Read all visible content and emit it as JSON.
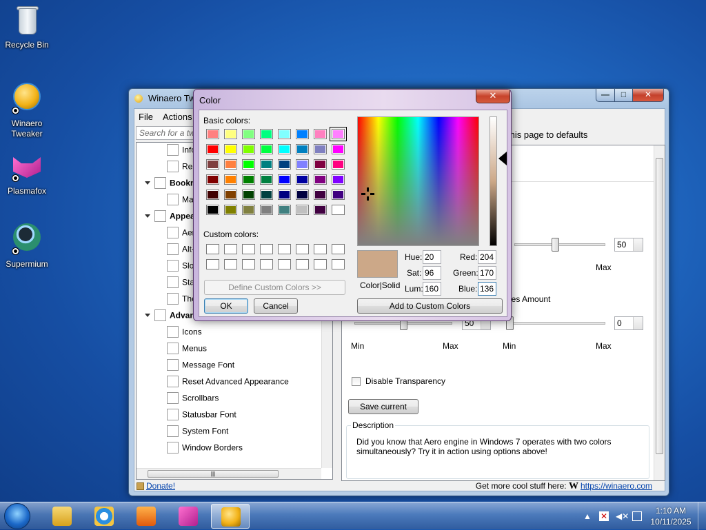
{
  "desktop": {
    "icons": [
      {
        "label": "Recycle Bin",
        "icon": "recycle-bin-icon"
      },
      {
        "label": "Winaero\nTweaker",
        "icon": "winaero-tweaker-icon"
      },
      {
        "label": "Plasmafox",
        "icon": "plasmafox-icon"
      },
      {
        "label": "Supermium",
        "icon": "supermium-icon"
      }
    ]
  },
  "window": {
    "title": "Winaero Twe",
    "menu": [
      "File",
      "Actions"
    ],
    "search_placeholder": "Search for a twe",
    "reset_link": "this page to defaults",
    "tree": [
      {
        "label": "Info",
        "icon": "info-icon",
        "bold": false
      },
      {
        "label": "Res",
        "icon": "refresh-icon",
        "bold": false
      },
      {
        "label": "Bookm",
        "icon": "star-icon",
        "bold": true
      },
      {
        "label": "Ma",
        "icon": "star-icon",
        "bold": false
      },
      {
        "label": "Appea",
        "icon": "palette-icon",
        "bold": true
      },
      {
        "label": "Aer",
        "icon": "window-icon",
        "bold": false
      },
      {
        "label": "Alt-",
        "icon": "alt-tab-icon",
        "bold": false
      },
      {
        "label": "Slo",
        "icon": "slow-animations-icon",
        "bold": false
      },
      {
        "label": "Sta",
        "icon": "startup-sound-icon",
        "bold": false
      },
      {
        "label": "The",
        "icon": "theme-icon",
        "bold": false
      },
      {
        "label": "Advanc",
        "icon": "palette-icon",
        "bold": true
      },
      {
        "label": "Icons",
        "icon": "icons-icon",
        "bold": false
      },
      {
        "label": "Menus",
        "icon": "menus-icon",
        "bold": false
      },
      {
        "label": "Message Font",
        "icon": "warning-icon",
        "bold": false
      },
      {
        "label": "Reset Advanced Appearance",
        "icon": "reset-icon",
        "bold": false
      },
      {
        "label": "Scrollbars",
        "icon": "scrollbars-icon",
        "bold": false
      },
      {
        "label": "Statusbar Font",
        "icon": "statusbar-font-icon",
        "bold": false
      },
      {
        "label": "System Font",
        "icon": "system-font-icon",
        "bold": false
      },
      {
        "label": "Window Borders",
        "icon": "window-borders-icon",
        "bold": false
      }
    ],
    "right": {
      "slider1": {
        "value": "50",
        "min_label": "",
        "max_label": "Max"
      },
      "stripes_label": "pes Amount",
      "slider2": {
        "value": "50",
        "min_label": "Min",
        "max_label": "Max"
      },
      "slider3": {
        "value": "0",
        "min_label": "Min",
        "max_label": "Max"
      },
      "disable_transparency": "Disable Transparency",
      "save_current": "Save current",
      "description_title": "Description",
      "description_text": "Did you know that Aero engine in Windows 7 operates with two colors simultaneously? Try it in action using options above!"
    },
    "status": {
      "donate": "Donate!",
      "more": "Get more cool stuff here:",
      "logo": "W",
      "url": "https://winaero.com"
    }
  },
  "color_dialog": {
    "title": "Color",
    "close": "✕",
    "basic_colors_label": "Basic colors:",
    "basic_colors": [
      "#ff8080",
      "#ffff80",
      "#80ff80",
      "#00ff80",
      "#80ffff",
      "#0080ff",
      "#ff80c0",
      "#ff80ff",
      "#ff0000",
      "#ffff00",
      "#80ff00",
      "#00ff40",
      "#00ffff",
      "#0080c0",
      "#8080c0",
      "#ff00ff",
      "#804040",
      "#ff8040",
      "#00ff00",
      "#008080",
      "#004080",
      "#8080ff",
      "#800040",
      "#ff0080",
      "#800000",
      "#ff8000",
      "#008000",
      "#008040",
      "#0000ff",
      "#0000a0",
      "#800080",
      "#8000ff",
      "#400000",
      "#804000",
      "#004000",
      "#004040",
      "#000080",
      "#000040",
      "#400040",
      "#400080",
      "#000000",
      "#808000",
      "#808040",
      "#808080",
      "#408080",
      "#c0c0c0",
      "#400040",
      "#ffffff"
    ],
    "selected_index": 7,
    "custom_colors_label": "Custom colors:",
    "define_custom": "Define Custom Colors >>",
    "ok": "OK",
    "cancel": "Cancel",
    "preview_color": "#cca888",
    "preview_label": "Color|Solid",
    "hue_label": "Hue:",
    "hue": "20",
    "sat_label": "Sat:",
    "sat": "96",
    "lum_label": "Lum:",
    "lum": "160",
    "red_label": "Red:",
    "red": "204",
    "green_label": "Green:",
    "green": "170",
    "blue_label": "Blue:",
    "blue": "136",
    "add_custom": "Add to Custom Colors"
  },
  "taskbar": {
    "items": [
      "explorer-icon",
      "internet-explorer-icon",
      "media-player-icon",
      "plasmafox-icon",
      "winaero-tweaker-icon"
    ],
    "active_index": 4,
    "time": "1:10 AM",
    "date": "10/11/2025"
  }
}
